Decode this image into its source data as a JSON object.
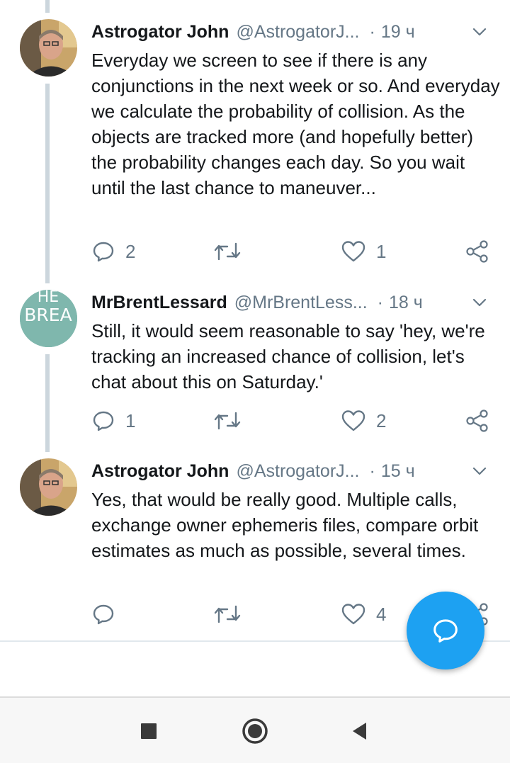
{
  "colors": {
    "accent": "#1da1f2",
    "text": "#14171a",
    "muted": "#657786",
    "thread_line": "#ccd6dd"
  },
  "tweets": [
    {
      "avatar": "person-photo-avatar",
      "name": "Astrogator John",
      "handle": "@AstrogatorJ...",
      "dot": "·",
      "time": "19 ч",
      "text": "Everyday we screen to see if there is any conjunctions in the next week or so. And everyday we calculate the probability of collision. As the objects are tracked more (and hopefully better) the probability changes each day. So you wait until the last chance to maneuver...",
      "replies": "2",
      "retweets": "",
      "likes": "1"
    },
    {
      "avatar": "brand-logo-avatar",
      "avatar_text_top": "HE",
      "avatar_text_main": "BREA",
      "name": "MrBrentLessard",
      "handle": "@MrBrentLess...",
      "dot": "·",
      "time": "18 ч",
      "text": "Still, it would seem reasonable to say 'hey, we're tracking an increased chance of collision, let's chat about this on Saturday.'",
      "replies": "1",
      "retweets": "",
      "likes": "2"
    },
    {
      "avatar": "person-photo-avatar",
      "name": "Astrogator John",
      "handle": "@AstrogatorJ...",
      "dot": "·",
      "time": "15 ч",
      "text": "Yes, that would be really good. Multiple calls, exchange owner ephemeris files, compare orbit estimates as much as possible, several times.",
      "replies": "",
      "retweets": "",
      "likes": "4"
    }
  ],
  "fab": {
    "icon": "compose-reply-icon"
  },
  "navbar": {
    "icons": [
      "recents-square-icon",
      "home-circle-icon",
      "back-triangle-icon"
    ]
  }
}
